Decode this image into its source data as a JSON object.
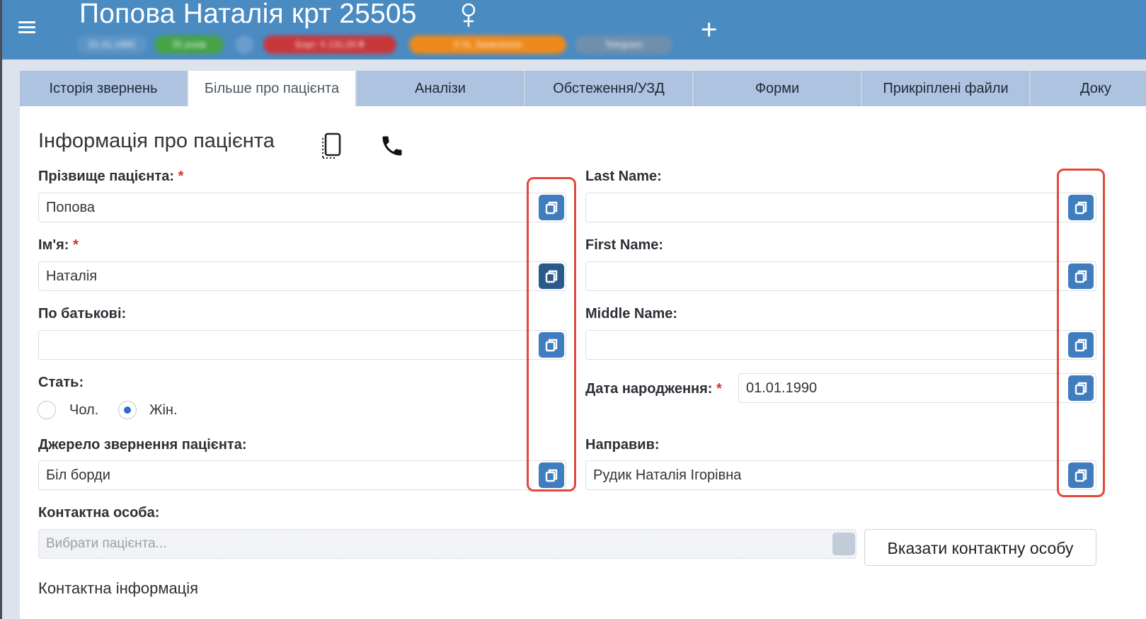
{
  "header": {
    "patient_title": "Попова Наталія крт 25505",
    "gender_icon": "female-symbol-icon",
    "pills": {
      "date": "01.01.1990",
      "age": "35 років",
      "debt": "Борг: 5 131,00 ₴",
      "discount": "5 %, Заявлення",
      "telegram": "Telegram"
    },
    "colors": {
      "bar": "#4a8bc2",
      "age": "#46a246",
      "debt": "#c9363a",
      "discount": "#ee8a1c"
    }
  },
  "tabs": [
    {
      "label": "Історія звернень"
    },
    {
      "label": "Більше про пацієнта",
      "active": true
    },
    {
      "label": "Аналізи"
    },
    {
      "label": "Обстеження/УЗД"
    },
    {
      "label": "Форми"
    },
    {
      "label": "Прикріплені файли"
    },
    {
      "label": "Доку"
    }
  ],
  "section_title": "Інформація про пацієнта",
  "form": {
    "last_name_ua": {
      "label": "Прізвище пацієнта:",
      "required": "*",
      "value": "Попова"
    },
    "first_name_ua": {
      "label": "Ім'я:",
      "required": "*",
      "value": "Наталія"
    },
    "middle_name_ua": {
      "label": "По батькові:",
      "value": ""
    },
    "gender": {
      "label": "Стать:",
      "male": "Чол.",
      "female": "Жін.",
      "selected": "female"
    },
    "source": {
      "label": "Джерело звернення пацієнта:",
      "value": "Біл борди"
    },
    "last_name_en": {
      "label": "Last Name:",
      "value": ""
    },
    "first_name_en": {
      "label": "First Name:",
      "value": ""
    },
    "middle_name_en": {
      "label": "Middle Name:",
      "value": ""
    },
    "birth_date": {
      "label": "Дата народження:",
      "required": "*",
      "value": "01.01.1990"
    },
    "referrer": {
      "label": "Направив:",
      "value": "Рудик Наталія Ігорівна"
    },
    "contact_person": {
      "label": "Контактна особа:",
      "placeholder": "Вибрати пацієнта...",
      "button": "Вказати контактну особу"
    },
    "contact_info": "Контактна інформація"
  }
}
